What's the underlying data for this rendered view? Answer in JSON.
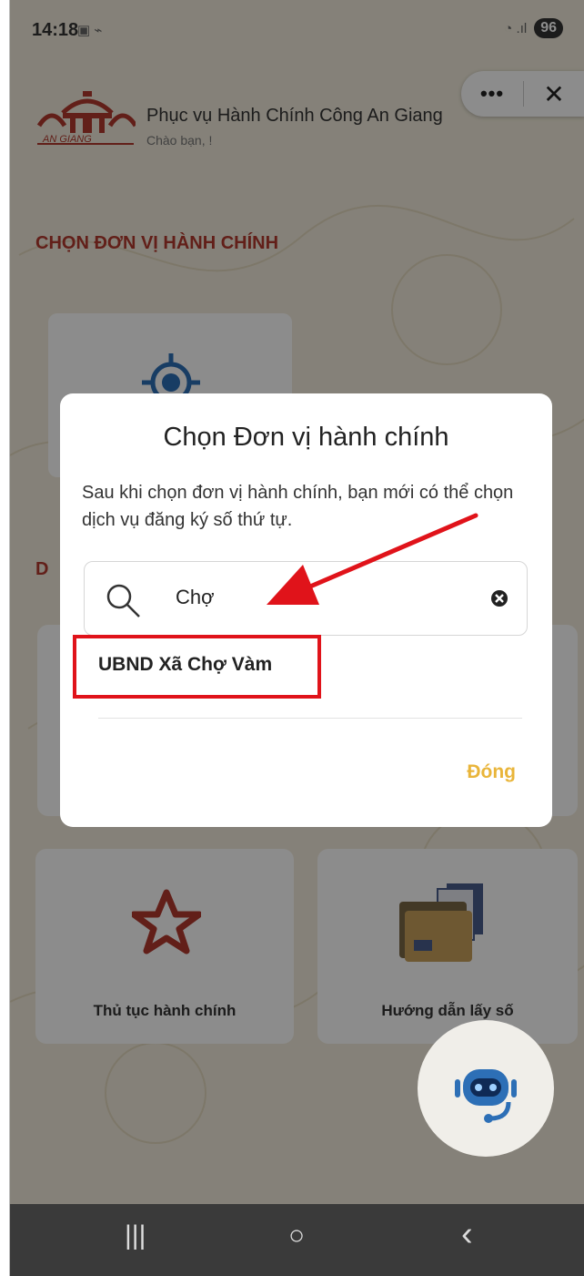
{
  "status_bar": {
    "time": "14:18",
    "battery": "96"
  },
  "header": {
    "title": "Phục vụ Hành Chính Công An Giang",
    "greeting": "Chào bạn, !",
    "logo_text": "AN GIANG"
  },
  "mini_program_capsule": {
    "more_label": "•••",
    "close_label": "✕"
  },
  "section_title": "CHỌN ĐƠN VỊ HÀNH CHÍNH",
  "section2_label": "D",
  "cards": [
    {
      "label": "Thủ tục hành chính",
      "icon": "star-logo-icon"
    },
    {
      "label": "Hướng dẫn lấy số",
      "icon": "folder-icon"
    }
  ],
  "dialog": {
    "title": "Chọn Đơn vị hành chính",
    "description": "Sau khi chọn đơn vị hành chính, bạn mới có thể chọn dịch vụ đăng ký số thứ tự.",
    "search": {
      "value": "Chợ",
      "placeholder": ""
    },
    "results": [
      "UBND Xã Chợ Vàm"
    ],
    "close_label": "Đóng"
  },
  "nav": {
    "recent": "|||",
    "home": "○",
    "back": "‹"
  },
  "colors": {
    "accent": "#e9b53a",
    "section": "#b23a2e",
    "annotation": "#e0131a"
  }
}
